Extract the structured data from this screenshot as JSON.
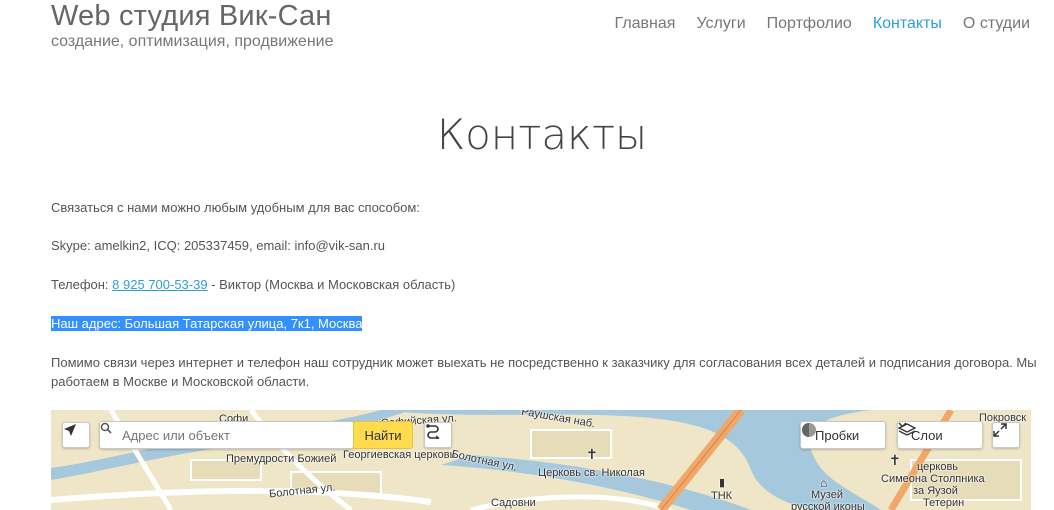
{
  "header": {
    "title": "Web студия Вик-Сан",
    "subtitle": "создание, оптимизация, продвижение"
  },
  "nav": {
    "items": [
      {
        "label": "Главная"
      },
      {
        "label": "Услуги"
      },
      {
        "label": "Портфолио"
      },
      {
        "label": "Контакты",
        "active": true
      },
      {
        "label": "О студии"
      }
    ]
  },
  "main": {
    "title": "Контакты",
    "intro": "Связаться с нами можно любым удобным для вас способом:",
    "messengers": "Skype: amelkin2, ICQ: 205337459, email: info@vik-san.ru",
    "phone_prefix": "Телефон: ",
    "phone_link": "8 925 700-53-39",
    "phone_suffix": " - Виктор (Москва и Московская область)",
    "address": "Наш адрес: Большая Татарская улица, 7к1, Москва",
    "description": "Помимо связи через интернет и телефон наш сотрудник может выехать не посредственно к заказчику для согласования всех деталей и подписания договора. Мы работаем в Москве и Московской области."
  },
  "map": {
    "search_placeholder": "Адрес или объект",
    "find_label": "Найти",
    "traffic_label": "Пробки",
    "layers_label": "Слои",
    "labels": {
      "l1": "Софи",
      "l2": "Премудрости Божией",
      "l3": "Георгиевская церковь",
      "l4": "Церковь св. Николая",
      "l5": "Болотная ул.",
      "l6": "Садовни",
      "l7": "ТНК",
      "l8": "Музей",
      "l9": "русской иконы",
      "l10": "церковь",
      "l11": "Симеона Столпника",
      "l12": "за Яузой",
      "l13": "Покровск",
      "l14": "Раушская наб.",
      "l15": "Болотная ул.",
      "l16": "Софийская ул.",
      "l17": "Тетерин"
    },
    "colors": {
      "land": "#efe6c7",
      "water": "#a6c8dc",
      "road": "#ffffff",
      "major_road": "#f0a86a",
      "accent_button": "#ffdb4d"
    }
  },
  "colors": {
    "accent": "#2b9fd8",
    "selection": "#3390ff"
  }
}
